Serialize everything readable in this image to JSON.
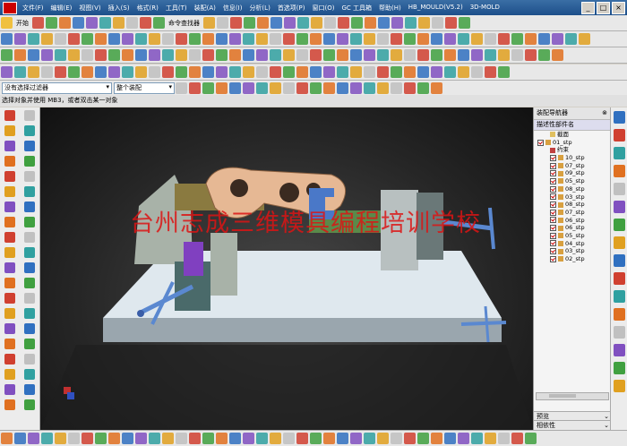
{
  "menu": [
    "文件(F)",
    "编辑(E)",
    "视图(V)",
    "插入(S)",
    "格式(R)",
    "工具(T)",
    "装配(A)",
    "信息(I)",
    "分析(L)",
    "首选项(P)",
    "窗口(O)",
    "GC 工具箱",
    "帮助(H)",
    "HB_MOULD(V5.2)",
    "3D-MOLD"
  ],
  "toolbar": {
    "start_label": "开始",
    "command_finder_label": "命令查找器"
  },
  "selection": {
    "filter_value": "没有选择过滤器",
    "scope_value": "整个装配"
  },
  "status_message": "选择对象并使用 MB3，或者双击某一对象",
  "watermark": "台州志成三维模具编程培训学校",
  "navigator": {
    "title": "装配导航器",
    "column_header": "描述性部件名",
    "items": [
      {
        "label": "截面",
        "level": 1,
        "type": "folder"
      },
      {
        "label": "01_stp",
        "level": 0,
        "type": "assembly"
      },
      {
        "label": "约束",
        "level": 1,
        "type": "constraint"
      },
      {
        "label": "10_stp",
        "level": 1,
        "type": "part"
      },
      {
        "label": "07_stp",
        "level": 1,
        "type": "part"
      },
      {
        "label": "09_stp",
        "level": 1,
        "type": "part"
      },
      {
        "label": "05_stp",
        "level": 1,
        "type": "part"
      },
      {
        "label": "08_stp",
        "level": 1,
        "type": "part"
      },
      {
        "label": "03_stp",
        "level": 1,
        "type": "part"
      },
      {
        "label": "08_stp",
        "level": 1,
        "type": "part"
      },
      {
        "label": "07_stp",
        "level": 1,
        "type": "part"
      },
      {
        "label": "06_stp",
        "level": 1,
        "type": "part"
      },
      {
        "label": "06_stp",
        "level": 1,
        "type": "part"
      },
      {
        "label": "05_stp",
        "level": 1,
        "type": "part"
      },
      {
        "label": "04_stp",
        "level": 1,
        "type": "part"
      },
      {
        "label": "03_stp",
        "level": 1,
        "type": "part"
      },
      {
        "label": "02_stp",
        "level": 1,
        "type": "part"
      }
    ],
    "panel_preview": "预览",
    "panel_dependency": "相依性"
  },
  "colors": {
    "title_bar": "#1d4f8a",
    "viewport_bg": "#2b2b2b",
    "base_plate": "#c8d4dc",
    "link_part": "#e6b894",
    "handle_blue": "#4a78c8",
    "watermark": "#dc1414"
  }
}
